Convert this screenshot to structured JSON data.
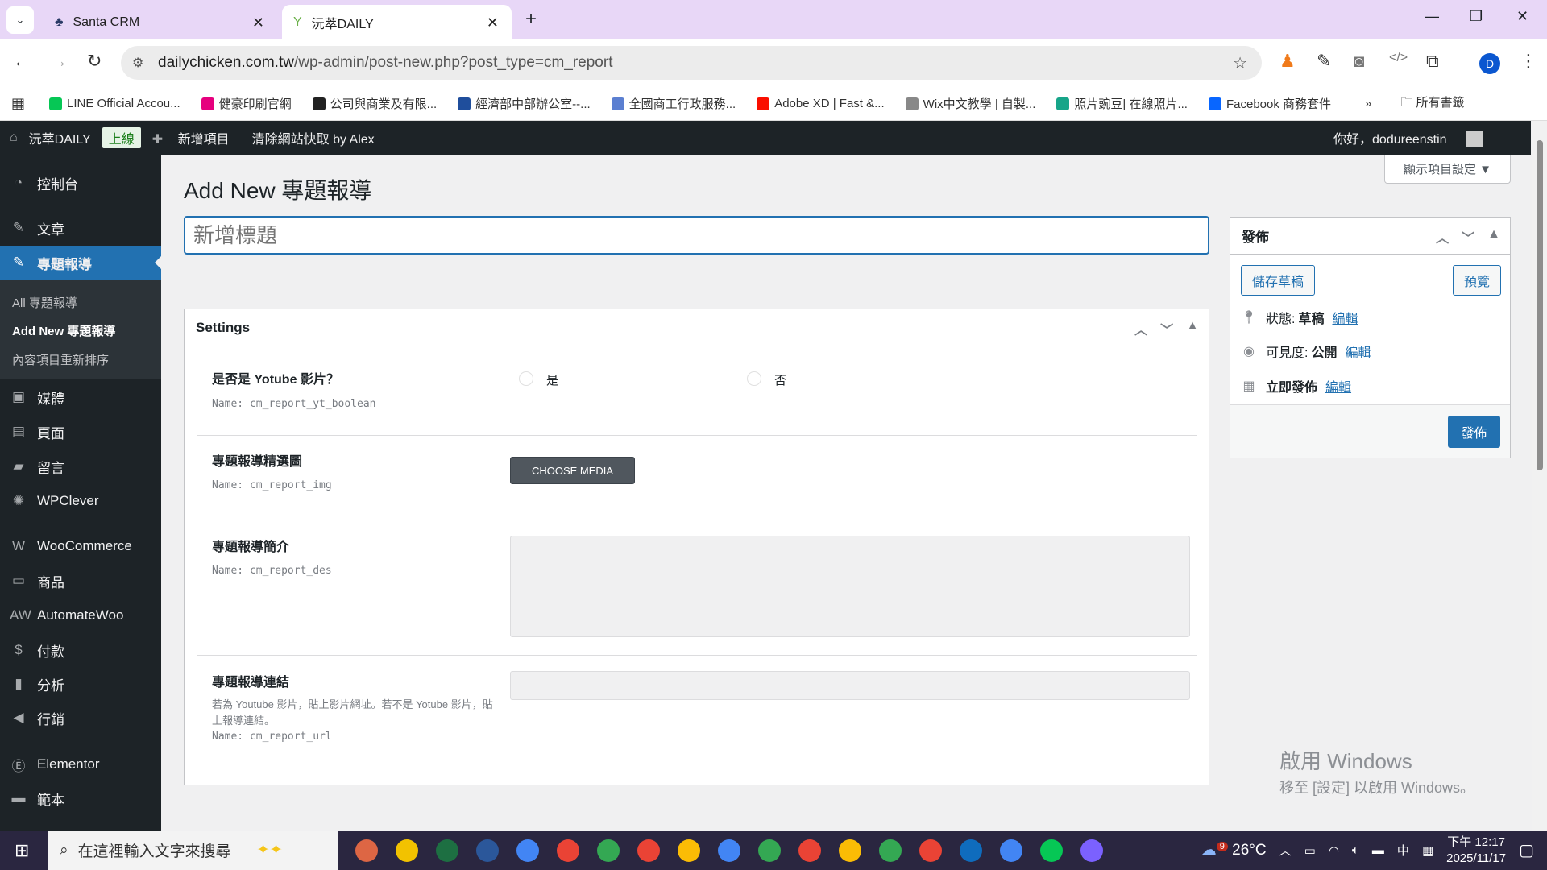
{
  "browser": {
    "tabs": [
      {
        "title": "Santa CRM"
      },
      {
        "title": "沅萃DAILY"
      }
    ],
    "url_host": "dailychicken.com.tw",
    "url_path": "/wp-admin/post-new.php?post_type=cm_report",
    "profile_initial": "D",
    "bookmarks": [
      {
        "label": "LINE Official Accou...",
        "color": "#06c755"
      },
      {
        "label": "健豪印刷官網",
        "color": "#e6007e"
      },
      {
        "label": "公司與商業及有限...",
        "color": "#222"
      },
      {
        "label": "經濟部中部辦公室--...",
        "color": "#1f4e9c"
      },
      {
        "label": "全國商工行政服務...",
        "color": "#5b7fd1"
      },
      {
        "label": "Adobe XD | Fast &...",
        "color": "#fa0f00"
      },
      {
        "label": "Wix中文教學 | 自製...",
        "color": "#888"
      },
      {
        "label": "照片豌豆| 在線照片...",
        "color": "#17a589"
      },
      {
        "label": "Facebook 商務套件",
        "color": "#0866ff"
      }
    ],
    "all_bookmarks": "所有書籤"
  },
  "adminbar": {
    "site": "沅萃DAILY",
    "live": "上線",
    "new_item": "新增項目",
    "clear_cache": "清除網站快取 by Alex",
    "greeting": "你好，dodureenstin"
  },
  "sidebar": {
    "items": [
      {
        "label": "控制台",
        "icon": "dashboard"
      },
      {
        "label": "文章",
        "icon": "pin"
      },
      {
        "label": "專題報導",
        "icon": "pin"
      },
      {
        "label": "媒體",
        "icon": "media"
      },
      {
        "label": "頁面",
        "icon": "page"
      },
      {
        "label": "留言",
        "icon": "comment"
      },
      {
        "label": "WPClever",
        "icon": "bulb"
      },
      {
        "label": "WooCommerce",
        "icon": "woo"
      },
      {
        "label": "商品",
        "icon": "box"
      },
      {
        "label": "AutomateWoo",
        "icon": "aw"
      },
      {
        "label": "付款",
        "icon": "dollar"
      },
      {
        "label": "分析",
        "icon": "chart"
      },
      {
        "label": "行銷",
        "icon": "megaphone"
      },
      {
        "label": "Elementor",
        "icon": "elementor"
      },
      {
        "label": "範本",
        "icon": "folder"
      }
    ],
    "submenu": [
      "All 專題報導",
      "Add New 專題報導",
      "內容項目重新排序"
    ]
  },
  "main": {
    "title": "Add New 專題報導",
    "title_placeholder": "新增標題",
    "screen_options": "顯示項目設定 ▼",
    "settings": {
      "heading": "Settings",
      "fields": [
        {
          "label": "是否是 Yotube 影片？",
          "name": "Name: cm_report_yt_boolean",
          "options": [
            "是",
            "否"
          ]
        },
        {
          "label": "專題報導精選圖",
          "name": "Name: cm_report_img",
          "button": "CHOOSE MEDIA"
        },
        {
          "label": "專題報導簡介",
          "name": "Name: cm_report_des"
        },
        {
          "label": "專題報導連結",
          "help": "若為 Youtube 影片，貼上影片網址。若不是 Yotube 影片，貼上報導連結。",
          "name": "Name: cm_report_url"
        }
      ]
    }
  },
  "publish": {
    "heading": "發佈",
    "save_draft": "儲存草稿",
    "preview": "預覽",
    "status_label": "狀態:",
    "status_value": "草稿",
    "visibility_label": "可見度:",
    "visibility_value": "公開",
    "schedule_label": "立即發佈",
    "edit": "編輯",
    "publish_button": "發佈"
  },
  "watermark": {
    "line1": "啟用 Windows",
    "line2": "移至 [設定] 以啟用 Windows。"
  },
  "taskbar": {
    "search_placeholder": "在這裡輸入文字來搜尋",
    "weather": "26°C",
    "weather_badge": "9",
    "ime": "中",
    "time": "下午 12:17",
    "date": "2025/11/17"
  }
}
